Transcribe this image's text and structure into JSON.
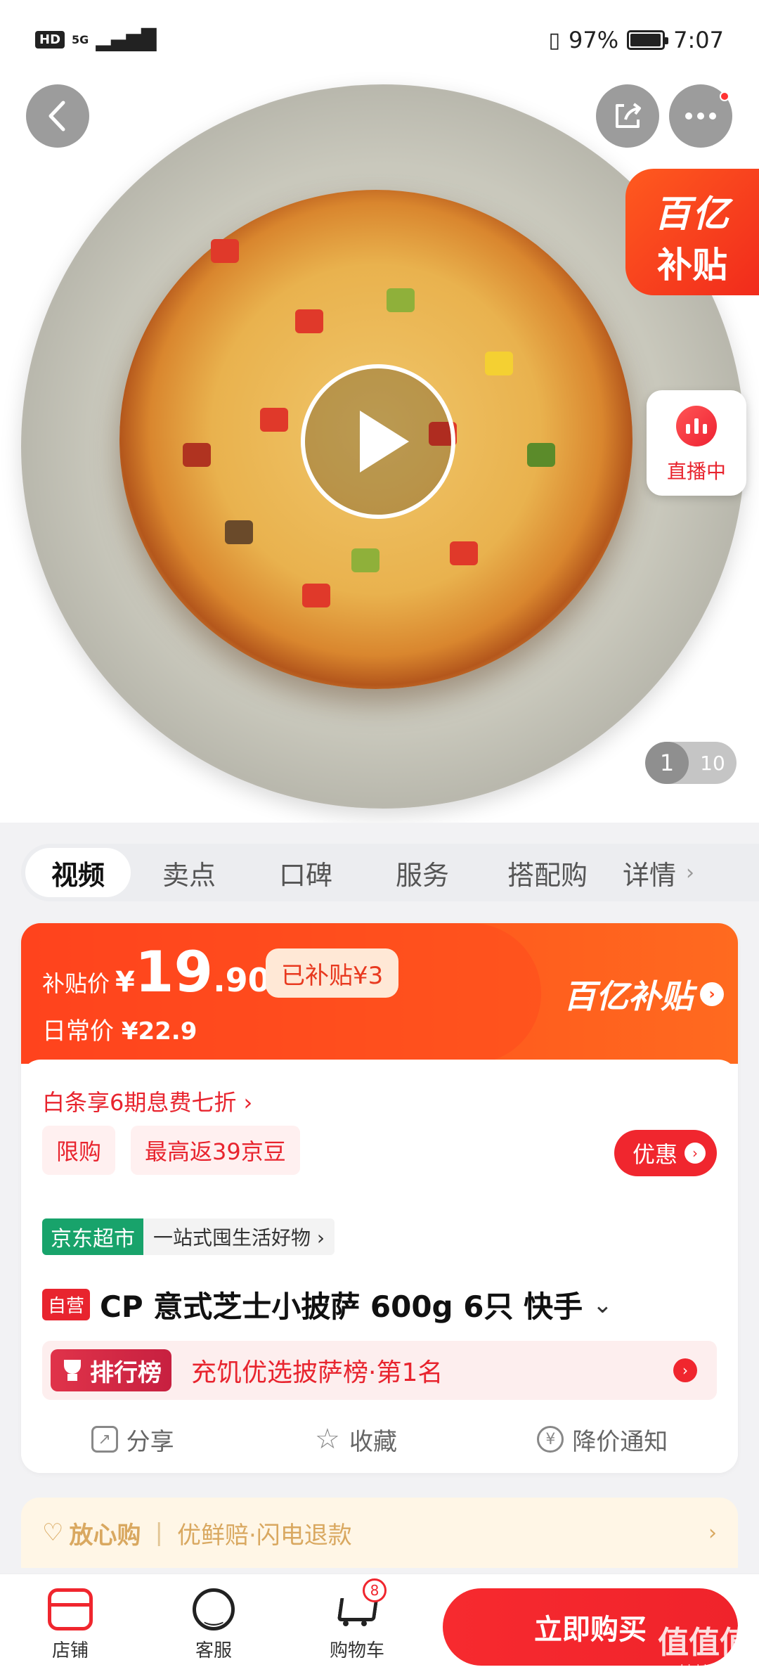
{
  "status_bar": {
    "hd": "HD",
    "network": "5G",
    "battery_text": "97%",
    "battery_level": 0.97,
    "time": "7:07"
  },
  "hero": {
    "back_icon": "chevron-left-icon",
    "share_icon": "share-icon",
    "more_icon": "more-icon",
    "subsidy_badge": {
      "line1": "百亿",
      "line2": "补贴"
    },
    "live_badge": {
      "label": "直播中"
    },
    "pager": {
      "current": "1",
      "total": "10"
    }
  },
  "tabs": [
    {
      "label": "视频",
      "active": true
    },
    {
      "label": "卖点"
    },
    {
      "label": "口碑"
    },
    {
      "label": "服务"
    },
    {
      "label": "搭配购"
    },
    {
      "label": "详情"
    }
  ],
  "tabs_more": "›",
  "price": {
    "label": "补贴价",
    "currency": "¥",
    "integer": "19",
    "decimal": ".90",
    "subsidized": "已补贴¥3",
    "normal_label": "日常价",
    "normal_value": "¥22.9",
    "brand": "百亿补贴",
    "brand_chev": "›"
  },
  "promo": {
    "baitiao": "白条享6期息费七折 ›",
    "chips": [
      "限购",
      "最高返39京豆"
    ],
    "coupon": "优惠",
    "coupon_chev": "›"
  },
  "shop": {
    "tag": "京东超市",
    "desc": "一站式囤生活好物 ›"
  },
  "product": {
    "self_tag": "自营",
    "title": "CP 意式芝士小披萨 600g 6只 快手",
    "chev": "⌄"
  },
  "rank": {
    "badge": "排行榜",
    "text": "充饥优选披萨榜·第1名",
    "chev": "›"
  },
  "actions": [
    {
      "label": "分享",
      "icon": "share-icon"
    },
    {
      "label": "收藏",
      "icon": "star-icon"
    },
    {
      "label": "降价通知",
      "icon": "yen-icon"
    }
  ],
  "guarantee": {
    "title": "放心购",
    "sep": "|",
    "text": "优鲜赔·闪电退款",
    "chev": "›"
  },
  "bottom_bar": {
    "store": "店铺",
    "service": "客服",
    "cart": "购物车",
    "cart_count": "8",
    "buy": "立即购买"
  },
  "watermark": {
    "big": "值值值",
    "small": "zhizhizhi.com"
  },
  "colors": {
    "accent": "#f0262e",
    "subsidy": "#ff4a1e",
    "green_tag": "#18a36b"
  }
}
